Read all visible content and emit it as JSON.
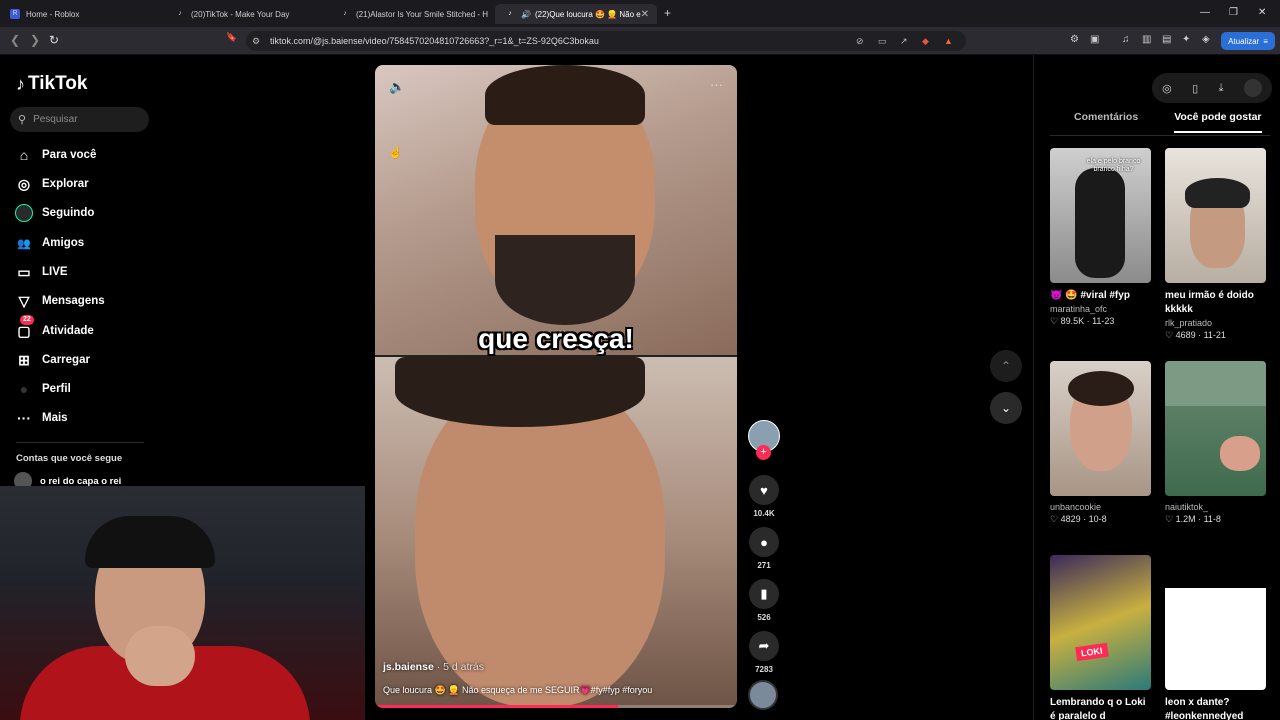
{
  "browser": {
    "tabs": [
      {
        "title": "Home - Roblox",
        "fav": "R"
      },
      {
        "title": "(20)TikTok - Make Your Day",
        "fav": "♪"
      },
      {
        "title": "(21)Alastor Is Your Smile Stitched - H",
        "fav": "♪"
      },
      {
        "title": "(22)Que loucura 🤩 👱 Não e",
        "fav": "♪"
      }
    ],
    "url": "tiktok.com/@js.baiense/video/7584570204810726663?_r=1&_t=ZS-92Q6C3bokau",
    "update_label": "Atualizar"
  },
  "sidebar": {
    "logo": "TikTok",
    "search_placeholder": "Pesquisar",
    "items": [
      {
        "label": "Para você",
        "icon": "⌂"
      },
      {
        "label": "Explorar",
        "icon": "◎"
      },
      {
        "label": "Seguindo",
        "icon": ""
      },
      {
        "label": "Amigos",
        "icon": "👥"
      },
      {
        "label": "LIVE",
        "icon": "▭"
      },
      {
        "label": "Mensagens",
        "icon": "▽"
      },
      {
        "label": "Atividade",
        "icon": "▢",
        "badge": "22"
      },
      {
        "label": "Carregar",
        "icon": "⊞"
      },
      {
        "label": "Perfil",
        "icon": "●"
      },
      {
        "label": "Mais",
        "icon": "···"
      }
    ],
    "following_title": "Contas que você segue",
    "following_item": "o rei do capa o rei"
  },
  "video": {
    "overlay_caption": "que cresça!",
    "author": "js.baiense",
    "time_ago": " · 5 d atrás",
    "description": "Que loucura 🤩 👱 Não esqueça de me SEGUIR💗#fy#fyp #foryou",
    "progress": 0.67
  },
  "actions": {
    "likes": "10.4K",
    "comments": "271",
    "saves": "526",
    "shares": "7283"
  },
  "right_panel": {
    "tabs": [
      "Comentários",
      "Você pode gostar"
    ],
    "cards": [
      {
        "title": "👿 🤩 #viral #fyp",
        "user": "maratinha_ofc",
        "stats": "♡ 89.5K · 11-23",
        "thumb_text": "ela é pelo branco branco filha?"
      },
      {
        "title": "meu irmão é doido kkkkk",
        "user": "rlk_pratiado",
        "stats": "♡ 4689 · 11-21"
      },
      {
        "title": "",
        "user": "unbancookie",
        "stats": "♡ 4829 · 10-8"
      },
      {
        "title": "",
        "user": "naiutiktok_",
        "stats": "♡ 1.2M · 11-8"
      },
      {
        "title": "Lembrando q o Loki é paralelo d",
        "user": "",
        "stats": "",
        "thumb_text": "LOKI"
      },
      {
        "title": "leon x dante? #leonkennedyed",
        "user": "",
        "stats": ""
      }
    ]
  },
  "colors": {
    "accent": "#fe2c55",
    "update": "#2a6fd6"
  }
}
